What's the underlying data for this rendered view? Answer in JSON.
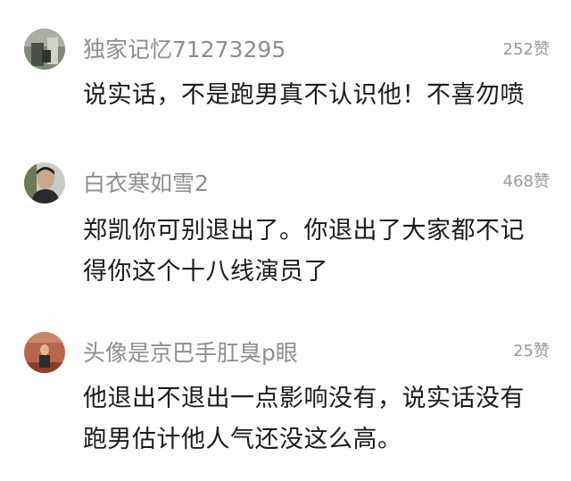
{
  "comments": [
    {
      "username": "独家记忆71273295",
      "likes": "252赞",
      "avatar": "grayscale-photo-avatar",
      "text_lines": [
        "说实话，不是跑男真不认识他！不喜勿喷"
      ]
    },
    {
      "username": "白衣寒如雪2",
      "likes": "468赞",
      "avatar": "portrait-photo-avatar",
      "text_lines": [
        "郑凯你可别退出了。你退出了大家都不记",
        "得你这个十八线演员了"
      ]
    },
    {
      "username": "头像是京巴手肛臭p眼",
      "likes": "25赞",
      "avatar": "red-wall-photo-avatar",
      "text_lines": [
        "他退出不退出一点影响没有，说实话没有",
        "跑男估计他人气还没这么高。"
      ]
    }
  ]
}
